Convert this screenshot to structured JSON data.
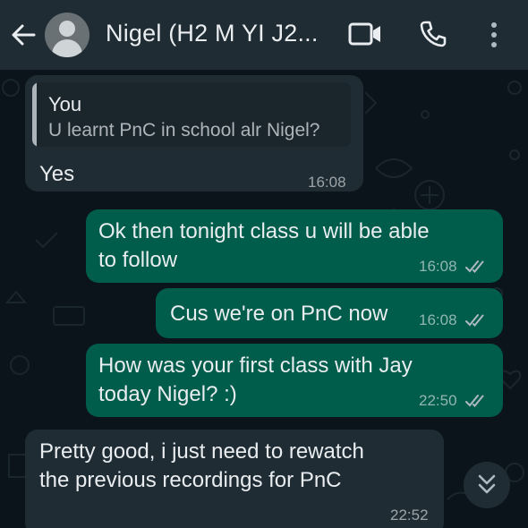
{
  "header": {
    "contact_name": "Nigel (H2 M YI J2...",
    "icons": {
      "back": "back-arrow-icon",
      "avatar": "default-avatar-icon",
      "video": "video-call-icon",
      "call": "voice-call-icon",
      "menu": "more-options-icon"
    }
  },
  "messages": [
    {
      "direction": "incoming",
      "reply_to": {
        "author": "You",
        "text": "U learnt PnC in school alr Nigel?"
      },
      "text": "Yes",
      "time": "16:08"
    },
    {
      "direction": "outgoing",
      "lines": [
        "Ok then tonight class u will be able",
        "to follow"
      ],
      "time": "16:08",
      "status": "read"
    },
    {
      "direction": "outgoing",
      "text": "Cus we're on PnC now",
      "time": "16:08",
      "status": "read"
    },
    {
      "direction": "outgoing",
      "lines": [
        "How was your first class with Jay",
        "today Nigel? :)"
      ],
      "time": "22:50",
      "status": "read"
    },
    {
      "direction": "incoming",
      "lines": [
        "Pretty good, i just need to rewatch",
        "the previous recordings for PnC"
      ],
      "time": "22:52"
    }
  ],
  "scroll_button": {
    "icon": "double-chevron-down-icon"
  },
  "colors": {
    "header_bg": "#1f2c34",
    "chat_bg": "#0b141a",
    "incoming_bubble": "#1f2c34",
    "outgoing_bubble": "#005c4b",
    "read_ticks": "#aebac1"
  }
}
